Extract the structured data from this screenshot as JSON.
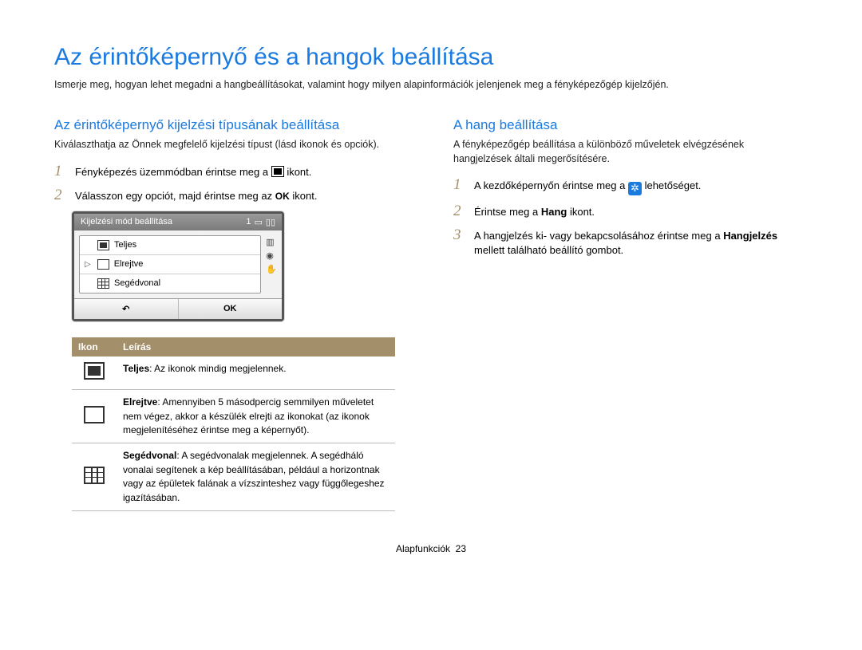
{
  "title": "Az érintőképernyő és a hangok beállítása",
  "subtitle": "Ismerje meg, hogyan lehet megadni a hangbeállításokat, valamint hogy milyen alapinformációk jelenjenek meg a fényképezőgép kijelzőjén.",
  "left": {
    "heading": "Az érintőképernyő kijelzési típusának beállítása",
    "intro": "Kiválaszthatja az Önnek megfelelő kijelzési típust (lásd ikonok és opciók).",
    "steps": [
      {
        "pre": "Fényképezés üzemmódban érintse meg a ",
        "post": " ikont."
      },
      {
        "pre": "Válasszon egy opciót, majd érintse meg az ",
        "ok": "OK",
        "post": " ikont."
      }
    ],
    "camera_ui": {
      "header": "Kijelzési mód beállítása",
      "header_right": "1",
      "options": [
        {
          "label": "Teljes",
          "type": "full"
        },
        {
          "label": "Elrejtve",
          "type": "hidden",
          "selected": true
        },
        {
          "label": "Segédvonal",
          "type": "grid"
        }
      ],
      "ok": "OK",
      "back": "↶"
    },
    "table": {
      "col_icon": "Ikon",
      "col_desc": "Leírás",
      "rows": [
        {
          "icon": "full",
          "bold": "Teljes",
          "text": ": Az ikonok mindig megjelennek."
        },
        {
          "icon": "hidden",
          "bold": "Elrejtve",
          "text": ": Amennyiben 5 másodpercig semmilyen műveletet nem végez, akkor a készülék elrejti az ikonokat (az ikonok megjelenítéséhez érintse meg a képernyőt)."
        },
        {
          "icon": "grid",
          "bold": "Segédvonal",
          "text": ": A segédvonalak megjelennek. A segédháló vonalai segítenek a kép beállításában, például a horizontnak vagy az épületek falának a vízszinteshez vagy függőlegeshez igazításában."
        }
      ]
    }
  },
  "right": {
    "heading": "A hang beállítása",
    "intro": "A fényképezőgép beállítása a különböző műveletek elvégzésének hangjelzések általi megerősítésére.",
    "steps": [
      {
        "pre": "A kezdőképernyőn érintse meg a ",
        "gear": true,
        "post": " lehetőséget."
      },
      {
        "pre": "Érintse meg a ",
        "bold": "Hang",
        "post": " ikont."
      },
      {
        "pre": "A hangjelzés ki- vagy bekapcsolásához érintse meg a ",
        "bold2": "Hangjelzés",
        "post2": " mellett található beállító gombot."
      }
    ]
  },
  "footer_label": "Alapfunkciók",
  "page_number": "23"
}
